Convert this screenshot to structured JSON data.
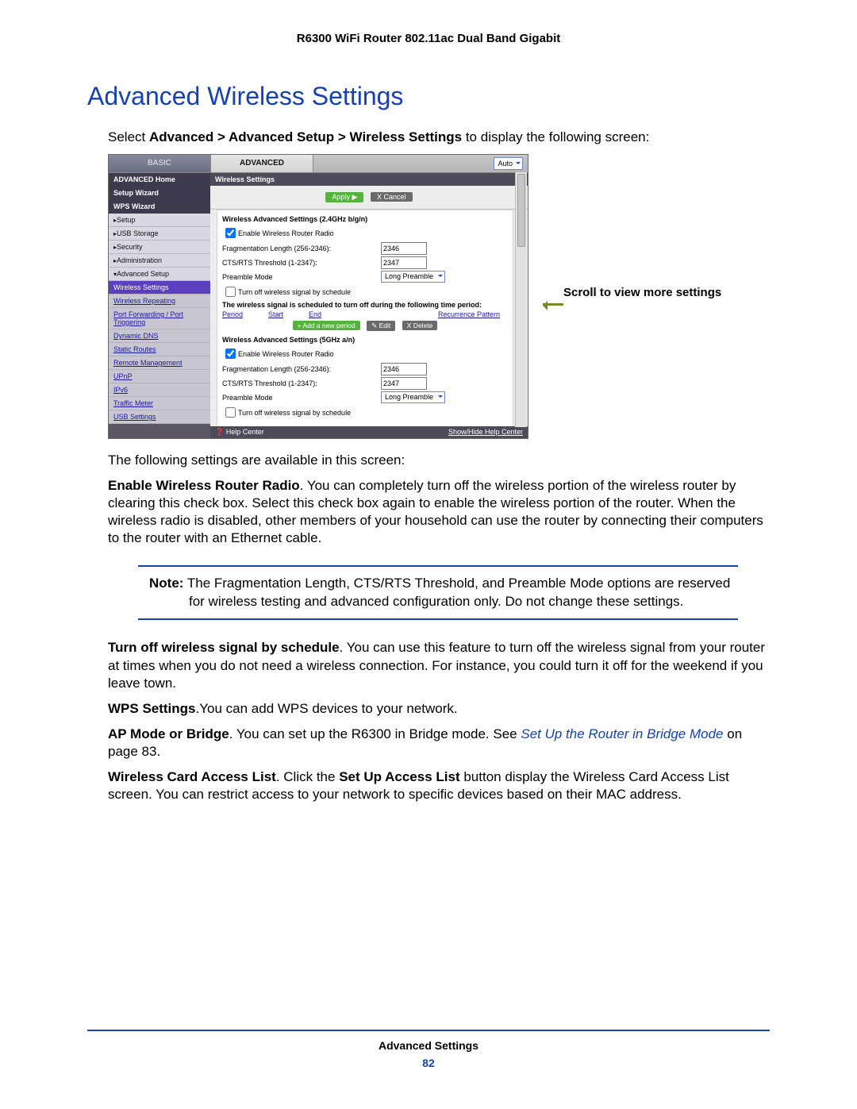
{
  "header": "R6300 WiFi Router 802.11ac Dual Band Gigabit",
  "title": "Advanced Wireless Settings",
  "intro": {
    "prefix": "Select ",
    "path": "Advanced > Advanced Setup > Wireless Settings",
    "suffix": " to display the following screen:"
  },
  "screenshot": {
    "tabs": {
      "basic": "BASIC",
      "advanced": "ADVANCED",
      "auto": "Auto"
    },
    "sidebar": {
      "home": "ADVANCED Home",
      "setup_wizard": "Setup Wizard",
      "wps_wizard": "WPS Wizard",
      "setup": "Setup",
      "usb": "USB Storage",
      "security": "Security",
      "admin": "Administration",
      "adv_setup": "Advanced Setup",
      "sub": {
        "wireless_settings": "Wireless Settings",
        "wireless_repeating": "Wireless Repeating",
        "port_fwd": "Port Forwarding / Port Triggering",
        "ddns": "Dynamic DNS",
        "static_routes": "Static Routes",
        "remote_mgmt": "Remote Management",
        "upnp": "UPnP",
        "ipv6": "IPv6",
        "traffic": "Traffic Meter",
        "usb_settings": "USB Settings"
      }
    },
    "main": {
      "title": "Wireless Settings",
      "apply": "Apply ▶",
      "cancel": "X Cancel",
      "sec24": {
        "heading": "Wireless Advanced Settings (2.4GHz b/g/n)",
        "enable": "Enable Wireless Router Radio",
        "frag_label": "Fragmentation Length (256-2346):",
        "frag_val": "2346",
        "cts_label": "CTS/RTS Threshold (1-2347):",
        "cts_val": "2347",
        "preamble_label": "Preamble Mode",
        "preamble_val": "Long Preamble",
        "sched_chk": "Turn off wireless signal by schedule",
        "sched_msg": "The wireless signal is scheduled to turn off during the following time period:",
        "cols": {
          "period": "Period",
          "start": "Start",
          "end": "End",
          "recur": "Recurrence Pattern"
        },
        "btn_add": "+ Add a new period",
        "btn_edit": "✎ Edit",
        "btn_del": "X  Delete"
      },
      "sec5": {
        "heading": "Wireless Advanced Settings (5GHz a/n)",
        "enable": "Enable Wireless Router Radio",
        "frag_label": "Fragmentation Length (256-2346):",
        "frag_val": "2346",
        "cts_label": "CTS/RTS Threshold (1-2347):",
        "cts_val": "2347",
        "preamble_label": "Preamble Mode",
        "preamble_val": "Long Preamble",
        "sched_chk": "Turn off wireless signal by schedule"
      },
      "help_center": "❓ Help Center",
      "show_hide": "Show/Hide Help Center"
    }
  },
  "callout": "Scroll to view more settings",
  "after_shot_intro": "The following settings are available in this screen:",
  "para_enable": {
    "bold": "Enable Wireless Router Radio",
    "rest": ". You can completely turn off the wireless portion of the wireless router by clearing this check box. Select this check box again to enable the wireless portion of the router. When the wireless radio is disabled, other members of your household can use the router by connecting their computers to the router with an Ethernet cable."
  },
  "note": {
    "label": "Note:",
    "text": "  The Fragmentation Length, CTS/RTS Threshold, and Preamble Mode options are reserved for wireless testing and advanced configuration only. Do not change these settings."
  },
  "para_sched": {
    "bold": "Turn off wireless signal by schedule",
    "rest": ". You can use this feature to turn off the wireless signal from your router at times when you do not need a wireless connection. For instance, you could turn it off for the weekend if you leave town."
  },
  "para_wps": {
    "bold": "WPS Settings",
    "rest": ".You can add WPS devices to your network."
  },
  "para_ap": {
    "bold": "AP Mode or Bridge",
    "mid": ". You can set up the R6300 in Bridge mode. See ",
    "link": "Set Up the Router in Bridge Mode",
    "tail": " on page 83."
  },
  "para_acl": {
    "bold": "Wireless Card Access List",
    "mid": ". Click the ",
    "bold2": "Set Up Access List",
    "rest": " button display the Wireless Card Access List screen. You can restrict access to your network to specific devices based on their MAC address."
  },
  "footer": {
    "section": "Advanced Settings",
    "page": "82"
  }
}
